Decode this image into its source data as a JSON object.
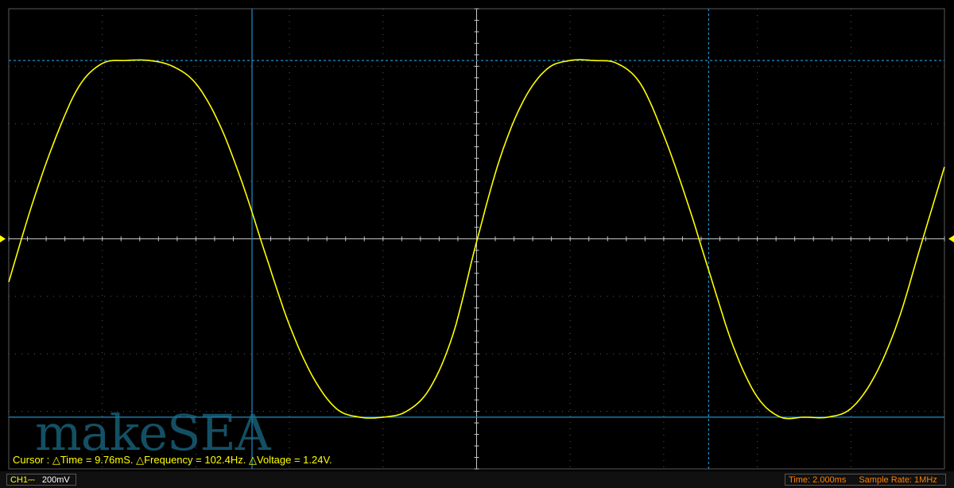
{
  "watermark": "makeSEA",
  "cursor_readout": {
    "prefix": "Cursor : ",
    "delta_time": "△Time = 9.76mS.",
    "delta_frequency": "△Frequency = 102.4Hz.",
    "delta_voltage": "△Voltage = 1.24V."
  },
  "status": {
    "channel": "CH1⎓",
    "volts_per_div": "200mV",
    "time_per_div": "Time: 2.000ms",
    "sample_rate": "Sample Rate: 1MHz"
  },
  "colors": {
    "background": "#000000",
    "grid": "#5a5a5a",
    "trace": "#ffff00",
    "cursor": "#1e90c8",
    "axis": "#c8c8c8"
  },
  "chart_data": {
    "type": "line",
    "title": "",
    "xlabel": "",
    "ylabel": "",
    "x_unit": "ms",
    "y_unit": "V",
    "xlim": [
      0,
      20
    ],
    "ylim": [
      -0.8,
      0.8
    ],
    "grid": true,
    "divisions": {
      "x": 10,
      "y": 8
    },
    "volts_per_div": 0.2,
    "time_per_div": 2.0,
    "series": [
      {
        "color": "#ffff00",
        "x": [
          0,
          0.5,
          1,
          1.5,
          2,
          2.5,
          3,
          3.5,
          4,
          4.5,
          5,
          5.5,
          6,
          6.5,
          7,
          7.5,
          8,
          8.5,
          9,
          9.5,
          10,
          10.5,
          11,
          11.5,
          12,
          12.5,
          13,
          13.5,
          14,
          14.5,
          15,
          15.5,
          16,
          16.5,
          17,
          17.5,
          18,
          18.5,
          19,
          19.5,
          20
        ],
        "y": [
          -0.15,
          0.12,
          0.35,
          0.53,
          0.61,
          0.62,
          0.62,
          0.6,
          0.54,
          0.4,
          0.19,
          -0.06,
          -0.3,
          -0.48,
          -0.59,
          -0.62,
          -0.62,
          -0.6,
          -0.52,
          -0.33,
          -0.01,
          0.28,
          0.48,
          0.59,
          0.62,
          0.62,
          0.61,
          0.54,
          0.36,
          0.13,
          -0.13,
          -0.38,
          -0.55,
          -0.62,
          -0.62,
          -0.62,
          -0.59,
          -0.48,
          -0.29,
          -0.02,
          0.25
        ]
      }
    ],
    "cursors": {
      "time": [
        5.2,
        14.96
      ],
      "voltage": [
        0.62,
        -0.62
      ]
    }
  }
}
